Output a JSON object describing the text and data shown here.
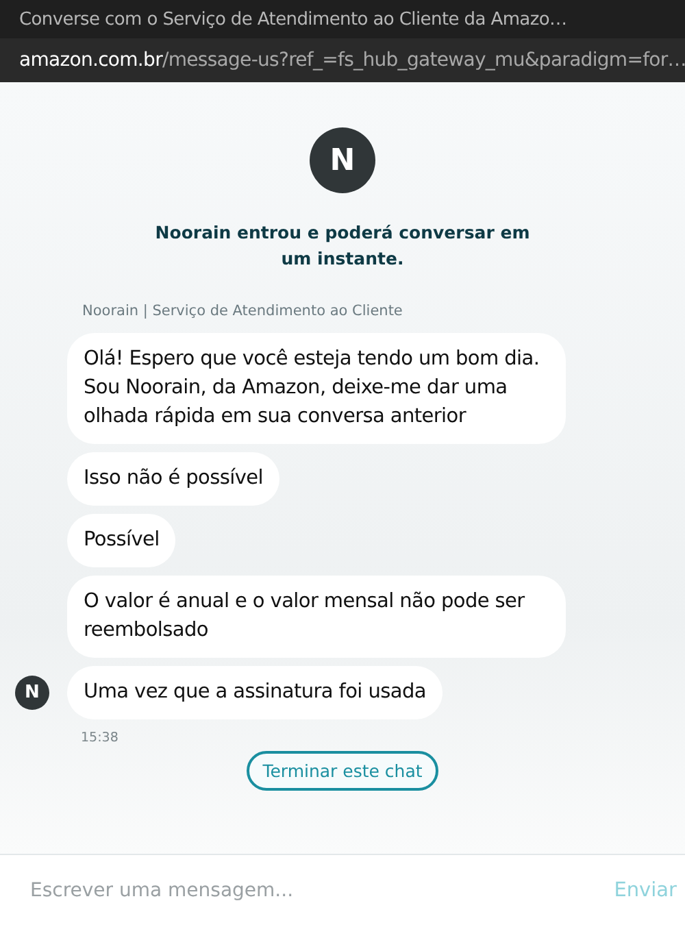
{
  "window": {
    "title": "Converse com o Serviço de Atendimento ao Cliente da Amazo…"
  },
  "address_bar": {
    "domain": "amazon.com.br",
    "path": "/message-us?ref_=fs_hub_gateway_mu&paradigm=for…"
  },
  "agent": {
    "initial": "N",
    "joined_text": "Noorain entrou e poderá conversar em um instante."
  },
  "sender_label": "Noorain | Serviço de Atendimento ao Cliente",
  "messages": [
    {
      "text": "Olá! Espero que você esteja tendo um bom dia. Sou Noorain, da Amazon, deixe-me dar uma olhada rápida em sua conversa anterior"
    },
    {
      "text": "Isso não é possível"
    },
    {
      "text": "Possível"
    },
    {
      "text": "O valor é anual e o valor mensal não pode ser reembolsado"
    },
    {
      "text": "Uma vez que a assinatura foi usada",
      "avatar": "N"
    }
  ],
  "timestamp": "15:38",
  "end_chat_button": "Terminar este chat",
  "composer": {
    "placeholder": "Escrever uma mensagem...",
    "send_button": "Enviar"
  }
}
